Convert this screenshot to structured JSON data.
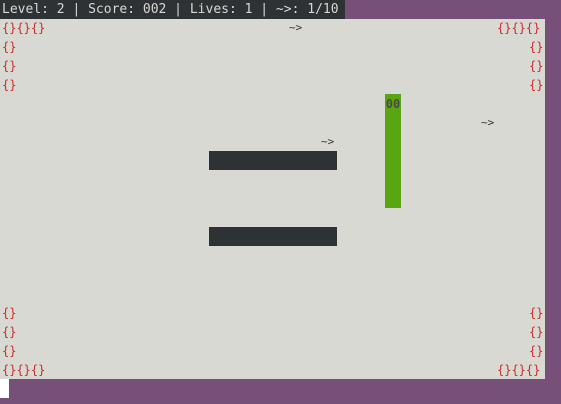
{
  "status_bar": {
    "text": "Level: 2 | Score: 002 | Lives: 1 | ~>: 1/10",
    "level": 2,
    "score": "002",
    "lives": 1,
    "food_collected": "1/10"
  },
  "border": {
    "corner_top_left": "{}{}{}",
    "corner_top_right": "{}{}{}",
    "corner_bottom_left": "{}{}{}",
    "corner_bottom_right": "{}{}{}",
    "brick": "{}"
  },
  "food": {
    "glyph": "~>"
  },
  "snake": {
    "head_glyph": "00",
    "color": "#5aa512"
  },
  "colors": {
    "background": "#77507a",
    "playfield": "#d9d9d4",
    "status_bar": "#2f3235",
    "brick": "#cc2a2a",
    "wall": "#2f3235"
  }
}
